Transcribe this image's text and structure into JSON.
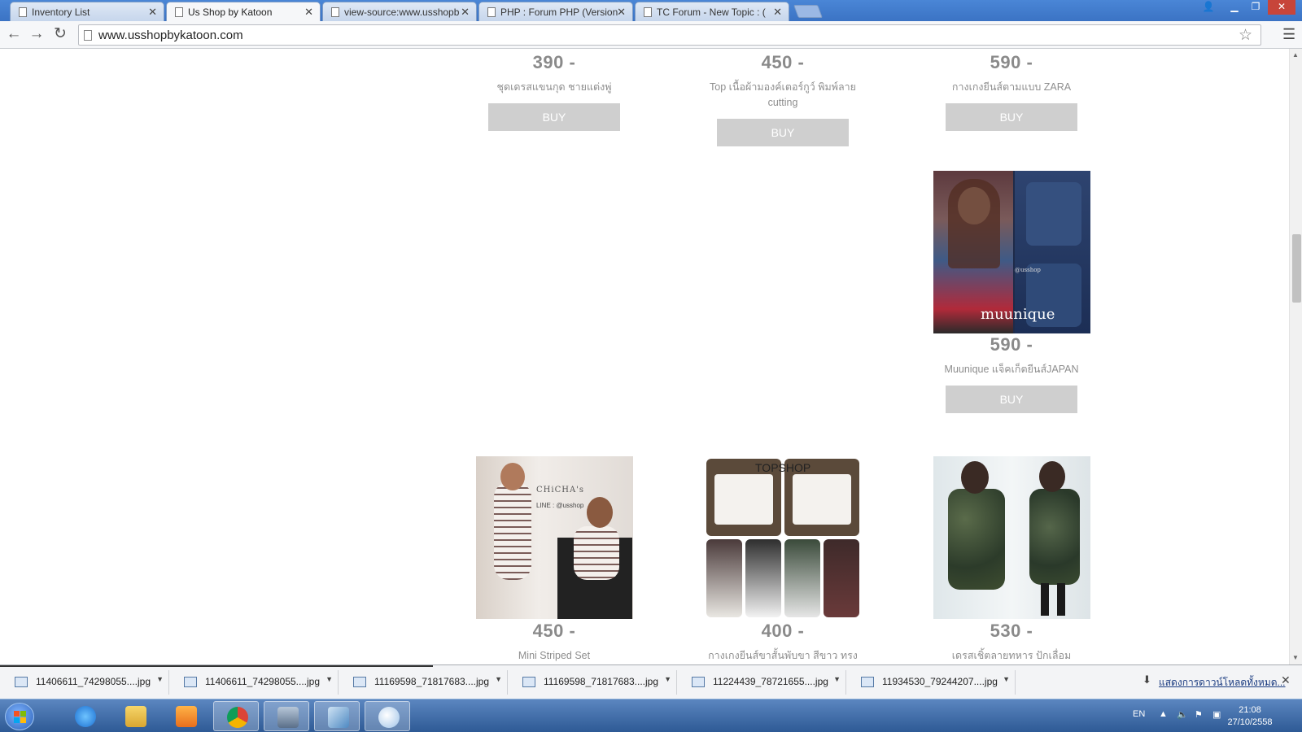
{
  "browser": {
    "tabs": [
      {
        "title": "Inventory List"
      },
      {
        "title": "Us Shop by Katoon"
      },
      {
        "title": "view-source:www.usshopb"
      },
      {
        "title": "PHP : Forum PHP (Version"
      },
      {
        "title": "TC Forum - New Topic : ("
      }
    ],
    "address": "www.usshopbykatoon.com"
  },
  "products": [
    {
      "price": "390 -",
      "name": "ชุดเดรสแขนกุด ชายแต่งพู่",
      "buy": "BUY"
    },
    {
      "price": "450 -",
      "name": "Top เนื้อผ้ามองค์เตอร์กูว์ พิมพ์ลาย cutting",
      "buy": "BUY"
    },
    {
      "price": "590 -",
      "name": "กางเกงยีนส์ตามแบบ ZARA",
      "buy": "BUY"
    },
    {
      "price": "590 -",
      "name": "Muunique แจ็คเก็ตยีนส์JAPAN",
      "buy": "BUY"
    },
    {
      "price": "450 -",
      "name": "Mini Striped Set"
    },
    {
      "price": "400 -",
      "name": "กางเกงยีนส์ขาสั้นพับขา สีขาว ทรง"
    },
    {
      "price": "530 -",
      "name": "เดรสเชิ้ตลายทหาร ปักเลื่อม"
    }
  ],
  "photo_labels": {
    "muunique": "muunique",
    "chicha": "CHiCHA's",
    "chicha_line": "LINE : @usshop",
    "topshop": "TOPSHOP",
    "watermark": "@usshop"
  },
  "downloads": {
    "items": [
      {
        "file": "11406611_74298055....jpg"
      },
      {
        "file": "11406611_74298055....jpg"
      },
      {
        "file": "11169598_71817683....jpg"
      },
      {
        "file": "11169598_71817683....jpg"
      },
      {
        "file": "11224439_78721655....jpg"
      },
      {
        "file": "11934530_79244207....jpg"
      }
    ],
    "show_all": "แสดงการดาวน์โหลดทั้งหมด..."
  },
  "taskbar": {
    "lang": "EN",
    "time": "21:08",
    "date": "27/10/2558"
  }
}
